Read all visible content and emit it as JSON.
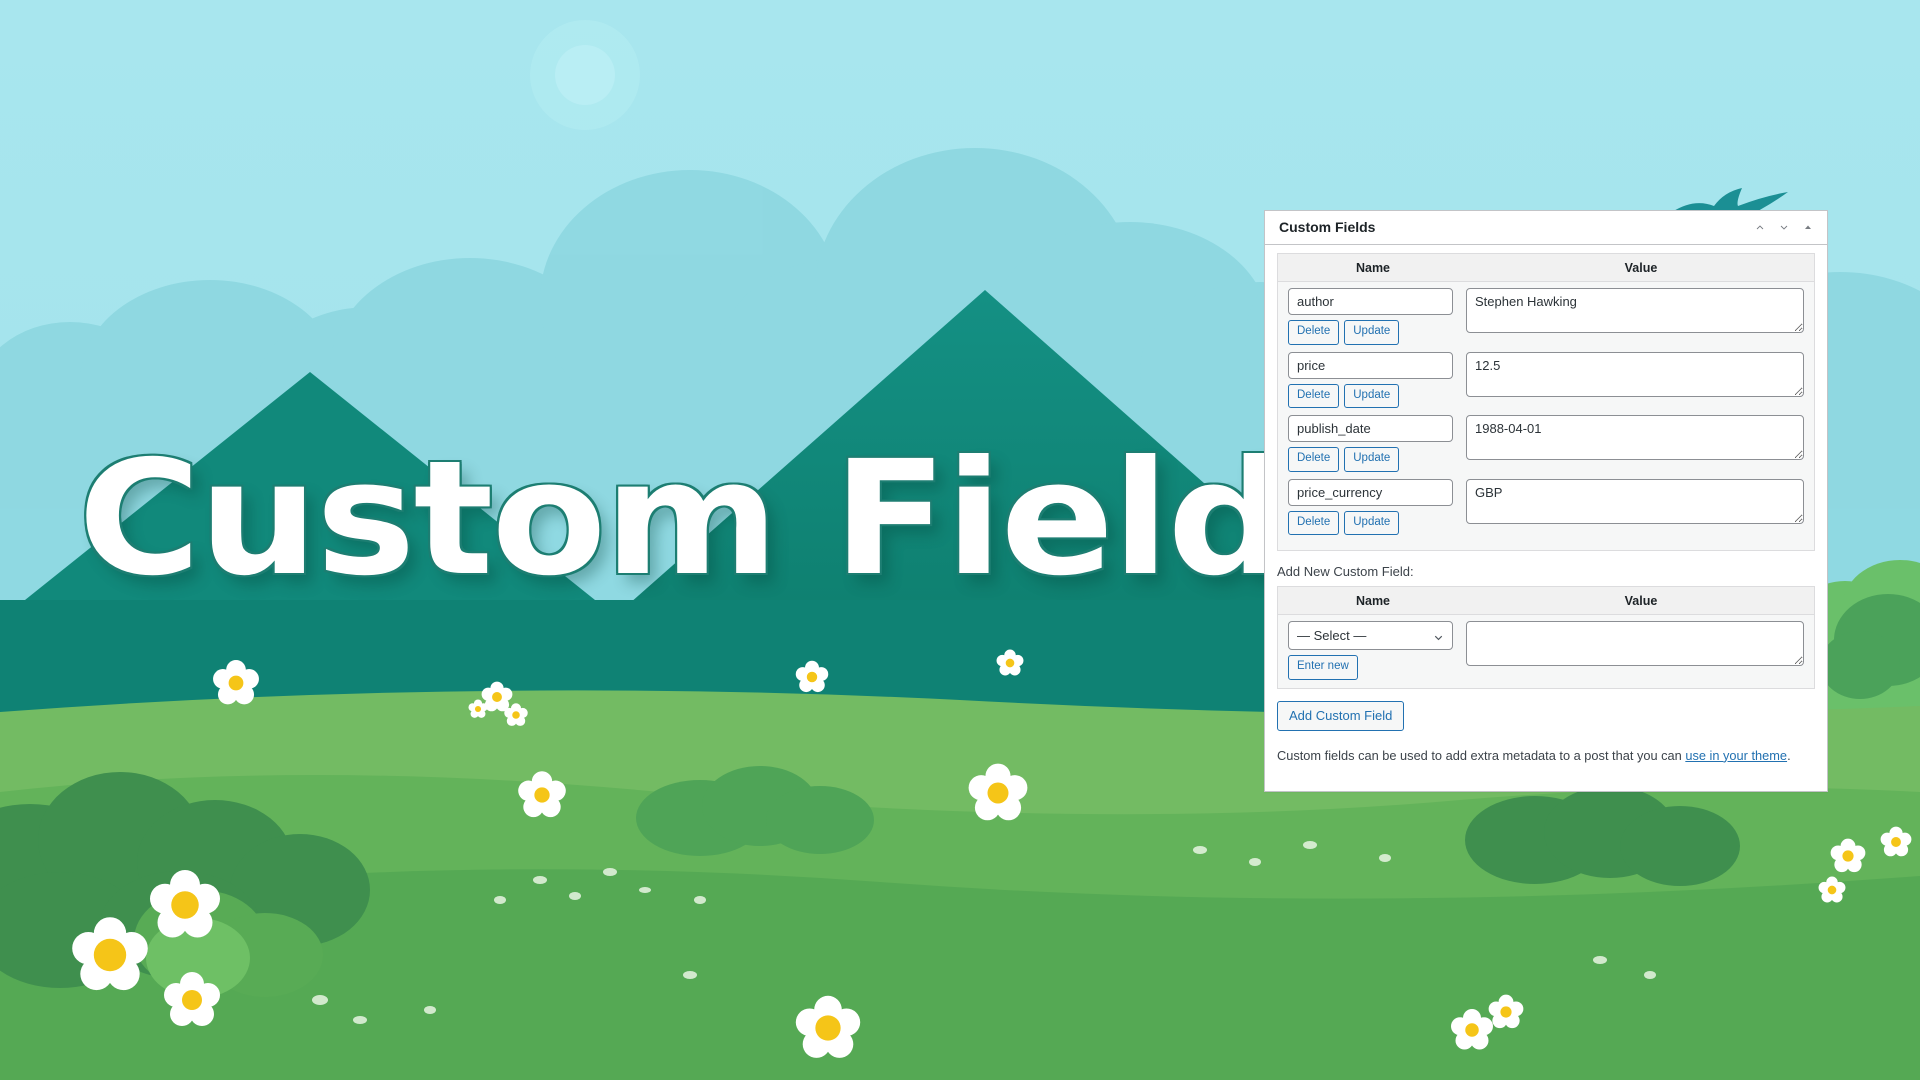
{
  "hero": {
    "title": "Custom Fields"
  },
  "panel": {
    "title": "Custom Fields",
    "header_actions": [
      {
        "name": "move-up-icon",
        "label": "Move up"
      },
      {
        "name": "move-down-icon",
        "label": "Move down"
      },
      {
        "name": "toggle-panel-icon",
        "label": "Toggle panel"
      }
    ],
    "table": {
      "headers": {
        "name": "Name",
        "value": "Value"
      },
      "rows": [
        {
          "name": "author",
          "value": "Stephen Hawking",
          "delete_label": "Delete",
          "update_label": "Update"
        },
        {
          "name": "price",
          "value": "12.5",
          "delete_label": "Delete",
          "update_label": "Update"
        },
        {
          "name": "publish_date",
          "value": "1988-04-01",
          "delete_label": "Delete",
          "update_label": "Update"
        },
        {
          "name": "price_currency",
          "value": "GBP",
          "delete_label": "Delete",
          "update_label": "Update"
        }
      ]
    },
    "add_new": {
      "label": "Add New Custom Field:",
      "headers": {
        "name": "Name",
        "value": "Value"
      },
      "select_value": "— Select —",
      "select_options": [
        "— Select —"
      ],
      "enter_new_label": "Enter new",
      "value_placeholder": "",
      "value_current": "",
      "add_button_label": "Add Custom Field"
    },
    "help": {
      "text_before": "Custom fields can be used to add extra metadata to a post that you can ",
      "link_text": "use in your theme",
      "text_after": "."
    }
  },
  "colors": {
    "sky": "#a5e3ec",
    "cloud": "#8fd9e0",
    "mountain_dark": "#0e7e6e",
    "mountain_mid": "#12897a",
    "grass_light": "#7dc06a",
    "grass_mid": "#5fae5a",
    "grass_dark": "#4f9f4f",
    "flower_yellow": "#f5c518",
    "accent_blue": "#2271b1",
    "panel_border": "#c3c4c7"
  }
}
